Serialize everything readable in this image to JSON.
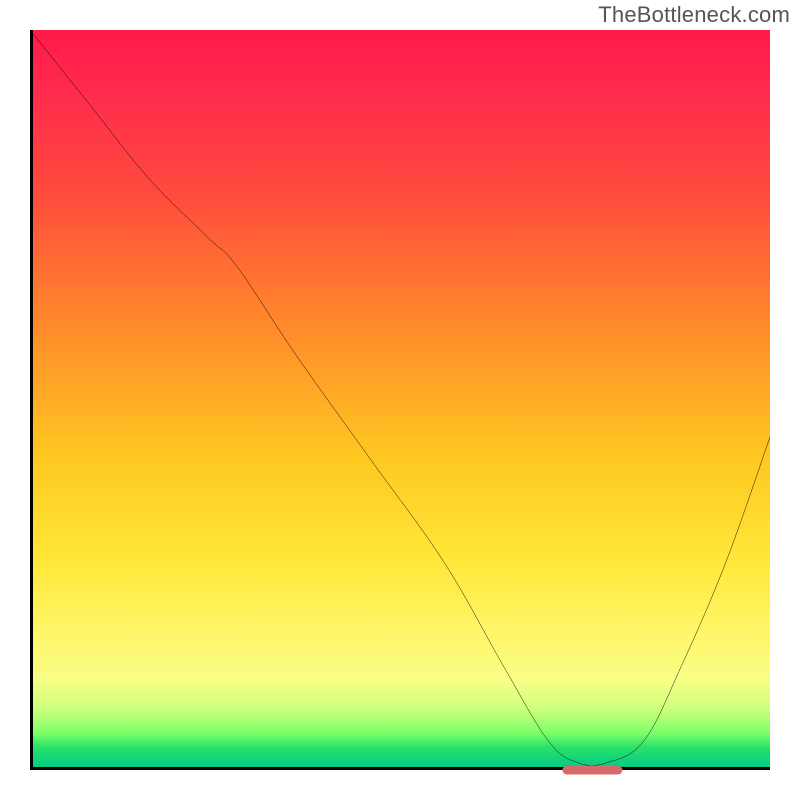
{
  "watermark": "TheBottleneck.com",
  "chart_data": {
    "type": "line",
    "title": "",
    "xlabel": "",
    "ylabel": "",
    "xlim": [
      0,
      100
    ],
    "ylim": [
      0,
      100
    ],
    "grid": false,
    "series": [
      {
        "name": "curve",
        "color": "#000000",
        "x": [
          0,
          8,
          16,
          24,
          28,
          36,
          46,
          56,
          64,
          70,
          74,
          78,
          83,
          88,
          94,
          100
        ],
        "y": [
          100,
          90,
          80,
          72,
          68,
          56,
          42,
          28,
          14,
          4,
          1,
          1,
          4,
          14,
          28,
          45
        ]
      }
    ],
    "marker": {
      "x_center_pct": 76,
      "width_pct": 8,
      "color": "#d66a6a"
    }
  }
}
